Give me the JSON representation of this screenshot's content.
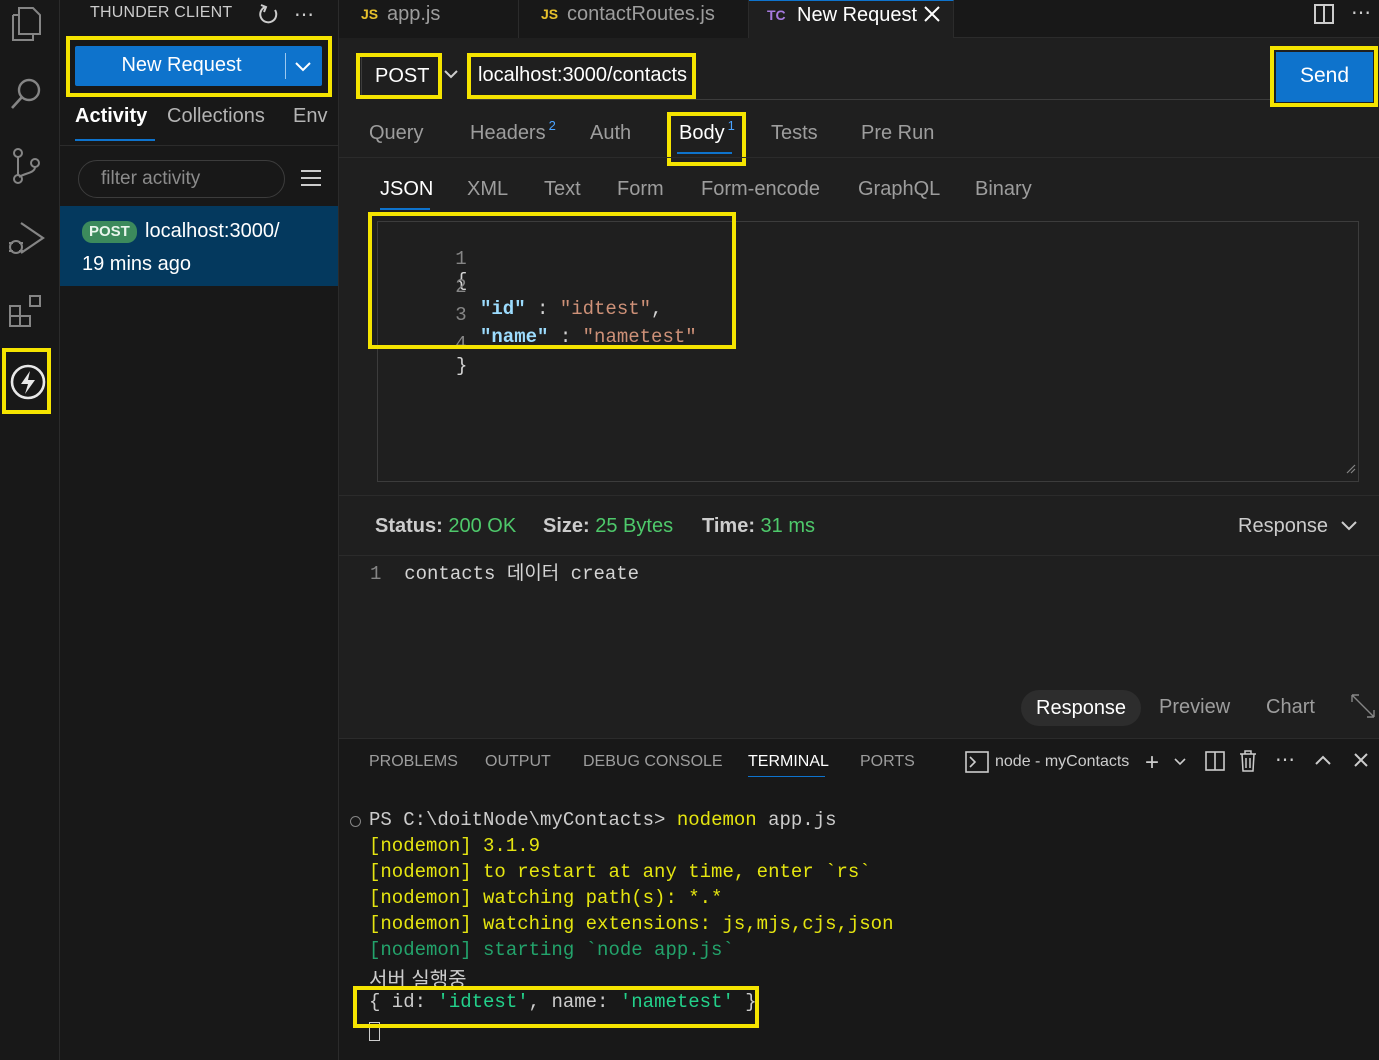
{
  "sidebar": {
    "title": "THUNDER CLIENT",
    "new_request_label": "New Request",
    "tabs": [
      "Activity",
      "Collections",
      "Env"
    ],
    "filter_placeholder": "filter activity",
    "activity_item": {
      "method": "POST",
      "url": "localhost:3000/",
      "time": "19 mins ago"
    }
  },
  "editor_tabs": [
    {
      "icon": "JS",
      "label": "app.js"
    },
    {
      "icon": "JS",
      "label": "contactRoutes.js"
    },
    {
      "icon": "TC",
      "label": "New Request"
    }
  ],
  "request": {
    "method": "POST",
    "url": "localhost:3000/contacts",
    "send_label": "Send",
    "tabs": {
      "query": "Query",
      "headers": "Headers",
      "headers_count": "2",
      "auth": "Auth",
      "body": "Body",
      "body_count": "1",
      "tests": "Tests",
      "pre_run": "Pre Run"
    },
    "body_tabs": [
      "JSON",
      "XML",
      "Text",
      "Form",
      "Form-encode",
      "GraphQL",
      "Binary"
    ],
    "body_lines": [
      {
        "n": "1",
        "open": "{"
      },
      {
        "n": "2",
        "key": "\"id\"",
        "sep": " : ",
        "val": "\"idtest\"",
        "end": ","
      },
      {
        "n": "3",
        "key": "\"name\"",
        "sep": " : ",
        "val": "\"nametest\"",
        "end": ""
      },
      {
        "n": "4",
        "open": "}"
      }
    ]
  },
  "response": {
    "status_label": "Status:",
    "status_value": "200 OK",
    "size_label": "Size:",
    "size_value": "25 Bytes",
    "time_label": "Time:",
    "time_value": "31 ms",
    "view_dropdown": "Response",
    "line_no": "1",
    "body": "contacts 데이터 create",
    "tabs": [
      "Response",
      "Preview",
      "Chart"
    ]
  },
  "panel": {
    "tabs": [
      "PROBLEMS",
      "OUTPUT",
      "DEBUG CONSOLE",
      "TERMINAL",
      "PORTS"
    ],
    "terminal_name": "node - myContacts",
    "prompt": "PS C:\\doitNode\\myContacts>",
    "command": "nodemon",
    "command_arg": "app.js",
    "lines": [
      "[nodemon] 3.1.9",
      "[nodemon] to restart at any time, enter `rs`",
      "[nodemon] watching path(s): *.*",
      "[nodemon] watching extensions: js,mjs,cjs,json",
      "[nodemon] starting `node app.js`"
    ],
    "korean_line": "서버 실행중",
    "obj_line": {
      "p1": "{ id: ",
      "v1": "'idtest'",
      "p2": ", name: ",
      "v2": "'nametest'",
      "p3": " }"
    }
  }
}
